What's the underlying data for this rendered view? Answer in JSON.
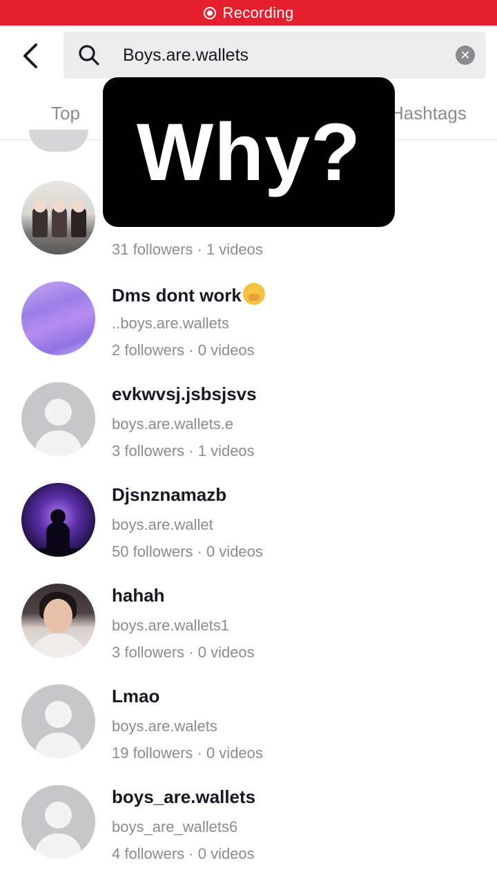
{
  "status_bar": {
    "recording_label": "Recording"
  },
  "search": {
    "query": "Boys.are.wallets"
  },
  "tabs": [
    {
      "label": "Top"
    },
    {
      "label": "Hashtags"
    }
  ],
  "overlay": {
    "text": "Why?"
  },
  "results": [
    {
      "display_name": "",
      "username": "",
      "followers": "31 followers",
      "videos": "1 videos"
    },
    {
      "display_name": "Dms dont work",
      "emoji": "shushing-face-emoji",
      "username": "..boys.are.wallets",
      "followers": "2 followers",
      "videos": "0 videos"
    },
    {
      "display_name": "evkwvsj.jsbsjsvs",
      "username": "boys.are.wallets.e",
      "followers": "3 followers",
      "videos": "1 videos"
    },
    {
      "display_name": "Djsnznamazb",
      "username": "boys.are.wallet",
      "followers": "50 followers",
      "videos": "0 videos"
    },
    {
      "display_name": "hahah",
      "username": "boys.are.wallets1",
      "followers": "3 followers",
      "videos": "0 videos"
    },
    {
      "display_name": "Lmao",
      "username": "boys.are.walets",
      "followers": "19 followers",
      "videos": "0 videos"
    },
    {
      "display_name": "boys_are.wallets",
      "username": "boys_are_wallets6",
      "followers": "4 followers",
      "videos": "0 videos"
    }
  ],
  "separator": " · ",
  "colors": {
    "recording_bar": "#e5202e",
    "secondary_text": "#8a8b91",
    "search_bg": "#ececed"
  }
}
